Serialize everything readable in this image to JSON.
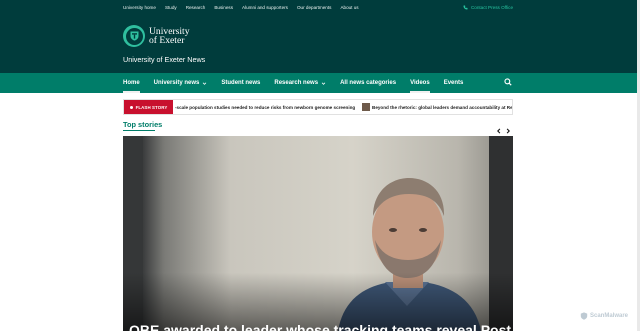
{
  "topbar": {
    "links": [
      "University home",
      "Study",
      "Research",
      "Business",
      "Alumni and supporters",
      "Our departments",
      "About us"
    ],
    "contact": "Contact Press Office"
  },
  "header": {
    "logo_line1": "University",
    "logo_line2": "of Exeter",
    "site_title": "University of Exeter News"
  },
  "nav": {
    "items": [
      {
        "label": "Home",
        "dropdown": false
      },
      {
        "label": "University news",
        "dropdown": true
      },
      {
        "label": "Student news",
        "dropdown": false
      },
      {
        "label": "Research news",
        "dropdown": true
      },
      {
        "label": "All news categories",
        "dropdown": false
      },
      {
        "label": "Videos",
        "dropdown": false
      },
      {
        "label": "Events",
        "dropdown": false
      }
    ],
    "active_items": [
      "Home",
      "Videos"
    ]
  },
  "flash": {
    "badge": "FLASH STORY",
    "headline1": "-scale population studies needed to reduce risks from newborn genome screening",
    "headline2": "Beyond the rhetoric: global leaders demand accountability at Repo"
  },
  "top_stories": {
    "heading": "Top stories",
    "hero_caption": "OBE awarded to leader whose tracking teams reveal Post Office Scandal"
  },
  "watermark": "ScanMalware",
  "colors": {
    "dark_teal": "#003c3c",
    "nav_green": "#007d69",
    "accent_green": "#27c4a0",
    "flash_red": "#c8102e"
  }
}
